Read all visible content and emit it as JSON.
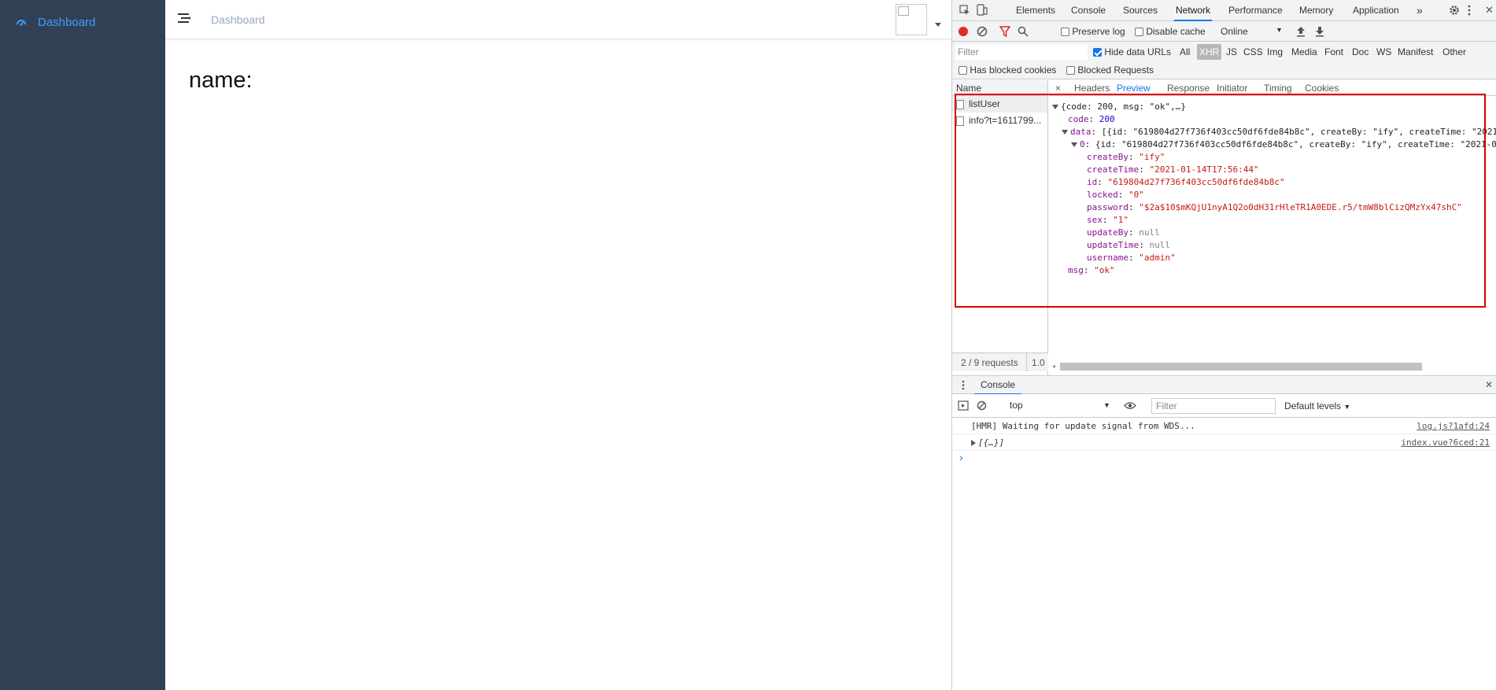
{
  "app": {
    "sidebar": {
      "items": [
        {
          "label": "Dashboard",
          "icon": "dashboard-icon"
        }
      ]
    },
    "navbar": {
      "breadcrumb": "Dashboard"
    },
    "main": {
      "text": "name:"
    }
  },
  "devtools": {
    "tabs": [
      "Elements",
      "Console",
      "Sources",
      "Network",
      "Performance",
      "Memory",
      "Application"
    ],
    "active_tab": "Network",
    "toolbar": {
      "preserve_log": "Preserve log",
      "disable_cache": "Disable cache",
      "throttle": "Online"
    },
    "filter": {
      "placeholder": "Filter",
      "hide_data_urls": "Hide data URLs",
      "types": [
        "All",
        "XHR",
        "JS",
        "CSS",
        "Img",
        "Media",
        "Font",
        "Doc",
        "WS",
        "Manifest",
        "Other"
      ],
      "active_type": "XHR",
      "has_blocked_cookies": "Has blocked cookies",
      "blocked_requests": "Blocked Requests"
    },
    "requests": {
      "header": "Name",
      "items": [
        "listUser",
        "info?t=1611799..."
      ],
      "footer": "2 / 9 requests",
      "footer_extra": "1.0"
    },
    "detail_tabs": [
      "×",
      "Headers",
      "Preview",
      "Response",
      "Initiator",
      "Timing",
      "Cookies"
    ],
    "active_detail_tab": "Preview",
    "preview": {
      "summary": "{code: 200, msg: \"ok\",…}",
      "code": "200",
      "data_summary": "[{id: \"619804d27f736f403cc50df6fde84b8c\", createBy: \"ify\", createTime: \"2021",
      "item0_summary": "{id: \"619804d27f736f403cc50df6fde84b8c\", createBy: \"ify\", createTime: \"2021-0",
      "fields": [
        {
          "key": "createBy",
          "value": "\"ify\"",
          "type": "string"
        },
        {
          "key": "createTime",
          "value": "\"2021-01-14T17:56:44\"",
          "type": "string"
        },
        {
          "key": "id",
          "value": "\"619804d27f736f403cc50df6fde84b8c\"",
          "type": "string"
        },
        {
          "key": "locked",
          "value": "\"0\"",
          "type": "string"
        },
        {
          "key": "password",
          "value": "\"$2a$10$mKQjU1nyA1Q2o0dH31rHleTR1A0EDE.r5/tmW8blCizQMzYx47shC\"",
          "type": "string"
        },
        {
          "key": "sex",
          "value": "\"1\"",
          "type": "string"
        },
        {
          "key": "updateBy",
          "value": "null",
          "type": "null"
        },
        {
          "key": "updateTime",
          "value": "null",
          "type": "null"
        },
        {
          "key": "username",
          "value": "\"admin\"",
          "type": "string"
        }
      ],
      "msg": "\"ok\""
    },
    "console": {
      "title": "Console",
      "context": "top",
      "filter_placeholder": "Filter",
      "levels": "Default levels",
      "lines": [
        {
          "text": "[HMR] Waiting for update signal from WDS...",
          "source": "log.js?1afd:24"
        },
        {
          "text": "[{…}]",
          "source": "index.vue?6ced:21"
        }
      ],
      "prompt": "›"
    },
    "colors": {
      "highlight_box": "#e00000",
      "accent": "#1a73e8",
      "record": "#d93025"
    }
  }
}
